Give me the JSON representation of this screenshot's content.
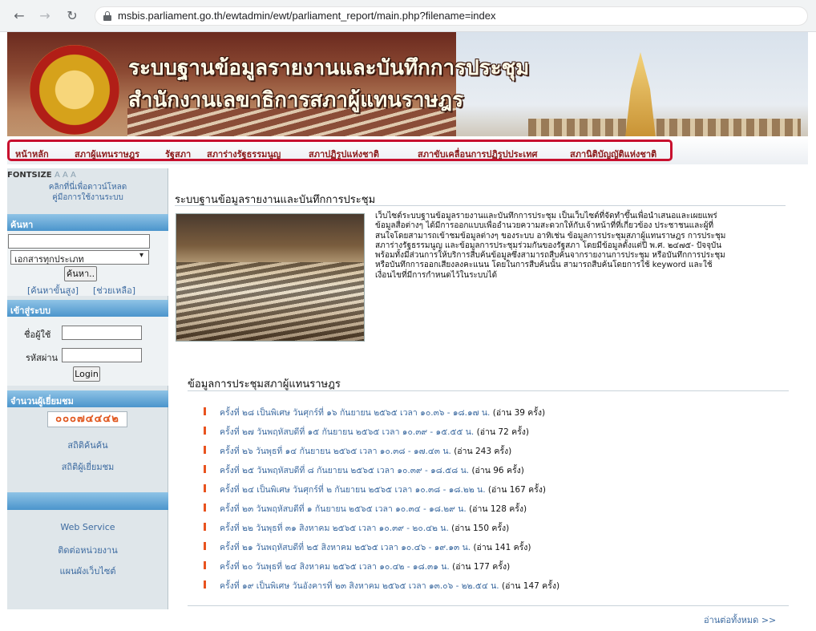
{
  "browser": {
    "url": "msbis.parliament.go.th/ewtadmin/ewt/parliament_report/main.php?filename=index"
  },
  "header": {
    "title_line1": "ระบบฐานข้อมูลรายงานและบันทึกการประชุม",
    "title_line2": "สำนักงานเลขาธิการสภาผู้แทนราษฎร"
  },
  "nav": {
    "items": [
      "หน้าหลัก",
      "สภาผู้แทนราษฎร",
      "รัฐสภา",
      "สภาร่างรัฐธรรมนูญ",
      "สภาปฏิรูปแห่งชาติ",
      "สภาขับเคลื่อนการปฏิรูปประเทศ",
      "สภานิติบัญญัติแห่งชาติ"
    ]
  },
  "sidebar": {
    "fontsize_label": "FONTSIZE",
    "fontsize_a": "A A A",
    "download_line1": "คลิกที่นี่เพื่อดาวน์โหลด",
    "download_line2": "คู่มือการใช้งานระบบ",
    "search_header": "ค้นหา",
    "search_select": "เอกสารทุกประเภท",
    "search_button": "ค้นหา..",
    "advanced_link": "[ค้นหาขั้นสูง]",
    "help_link": "[ช่วยเหลือ]",
    "login_header": "เข้าสู่ระบบ",
    "username_label": "ชื่อผู้ใช้",
    "password_label": "รหัสผ่าน",
    "login_button": "Login",
    "visitors_header": "จำนวนผู้เยี่ยมชม",
    "visitor_count": "๐๐๐๗๔๔๔๒",
    "stats_search": "สถิติค้นค้น",
    "stats_visitors": "สถิติผู้เยี่ยมชม",
    "web_service": "Web Service",
    "contact": "ติดต่อหน่วยงาน",
    "sitemap": "แผนผังเว็บไซต์"
  },
  "main": {
    "title": "ระบบฐานข้อมูลรายงานและบันทึกการประชุม",
    "intro_lines": [
      "เว็บไซต์ระบบฐานข้อมูลรายงานและบันทึกการประชุม  เป็นเว็บไซต์ที่จัดทำขึ้นเพื่อนำเสนอและเผยแพร่",
      "ข้อมูลสื่อต่างๆ  ได้มีการออกแบบเพื่ออำนวยความสะดวกให้กับเจ้าหน้าที่ที่เกี่ยวข้อง  ประชาชนและผู้ที่",
      "สนใจโดยสามารถเข้าชมข้อมูลต่างๆ ของระบบ อาทิเช่น ข้อมูลการประชุมสภาผู้แทนราษฎร การประชุม",
      "สภาร่างรัฐธรรมนูญ และข้อมูลการประชุมร่วมกันของรัฐสภา โดยมีข้อมูลตั้งแต่ปี พ.ศ. ๒๔๗๕- ปัจจุบัน",
      "พร้อมทั้งมีส่วนการให้บริการสืบค้นข้อมูลซึ่งสามารถสืบค้นจากรายงานการประชุม  หรือบันทึกการประชุม",
      "หรือบันทึกการออกเสียงลงคะแนน  โดยในการสืบค้นนั้น  สามารถสืบค้นโดยการใช้  keyword  และใช้",
      "เงื่อนไขที่มีการกำหนดไว้ในระบบได้"
    ],
    "section_title": "ข้อมูลการประชุมสภาผู้แทนราษฎร",
    "records": [
      {
        "text": "ครั้งที่ ๒๘ เป็นพิเศษ วันศุกร์ที่ ๑๖ กันยายน ๒๕๖๕ เวลา ๑๐.๓๖ - ๑๘.๑๗ น.",
        "count": "(อ่าน 39 ครั้ง)"
      },
      {
        "text": "ครั้งที่ ๒๗ วันพฤหัสบดีที่ ๑๕ กันยายน ๒๕๖๕ เวลา ๑๐.๓๙ - ๑๕.๕๕ น.",
        "count": "(อ่าน 72 ครั้ง)"
      },
      {
        "text": "ครั้งที่ ๒๖ วันพุธที่ ๑๔ กันยายน ๒๕๖๕ เวลา ๑๐.๓๘ - ๑๗.๔๓ น.",
        "count": "(อ่าน 243 ครั้ง)"
      },
      {
        "text": "ครั้งที่ ๒๕ วันพฤหัสบดีที่ ๘ กันยายน ๒๕๖๕ เวลา ๑๐.๓๙ - ๑๘.๕๘ น.",
        "count": "(อ่าน 96 ครั้ง)"
      },
      {
        "text": "ครั้งที่ ๒๔ เป็นพิเศษ วันศุกร์ที่ ๒ กันยายน ๒๕๖๕ เวลา ๑๐.๓๘ - ๑๘.๒๒ น.",
        "count": "(อ่าน 167 ครั้ง)"
      },
      {
        "text": "ครั้งที่ ๒๓ วันพฤหัสบดีที่ ๑ กันยายน ๒๕๖๕ เวลา ๑๐.๓๔ - ๑๘.๒๙ น.",
        "count": "(อ่าน 128 ครั้ง)"
      },
      {
        "text": "ครั้งที่ ๒๒ วันพุธที่ ๓๑ สิงหาคม ๒๕๖๕ เวลา ๑๐.๓๙ - ๒๐.๔๒ น.",
        "count": "(อ่าน 150 ครั้ง)"
      },
      {
        "text": "ครั้งที่ ๒๑ วันพฤหัสบดีที่ ๒๕ สิงหาคม ๒๕๖๕ เวลา ๑๐.๔๖ - ๑๙.๑๓ น.",
        "count": "(อ่าน 141 ครั้ง)"
      },
      {
        "text": "ครั้งที่ ๒๐ วันพุธที่ ๒๔ สิงหาคม ๒๕๖๕ เวลา ๑๐.๔๒ - ๑๘.๓๑ น.",
        "count": "(อ่าน 177 ครั้ง)"
      },
      {
        "text": "ครั้งที่ ๑๙ เป็นพิเศษ วันอังคารที่ ๒๓ สิงหาคม ๒๕๖๕ เวลา ๑๓.๐๖ - ๒๒.๕๔ น.",
        "count": "(อ่าน 147 ครั้ง)"
      }
    ],
    "read_all": "อ่านต่อทั้งหมด >>"
  }
}
